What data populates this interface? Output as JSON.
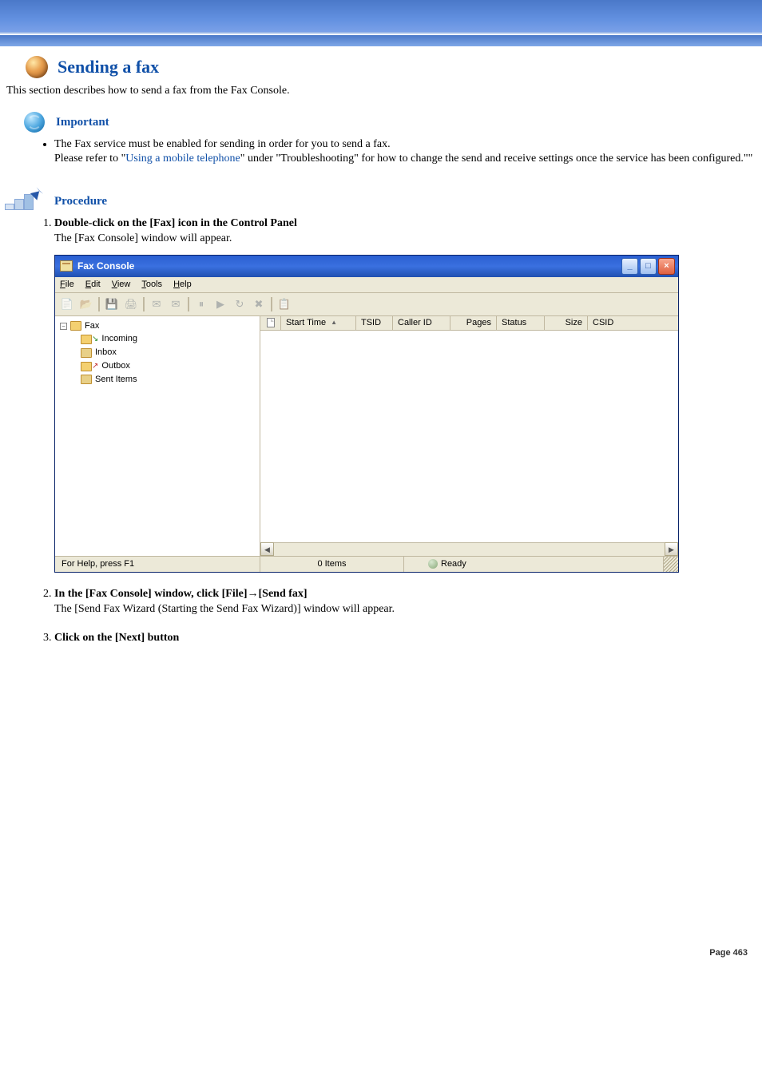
{
  "page_title": "Sending a fax",
  "intro_text": "This section describes how to send a fax from the Fax Console.",
  "important": {
    "label": "Important",
    "lines": [
      "The Fax service must be enabled for sending in order for you to send a fax.",
      "Please refer to \"",
      "Using a mobile telephone",
      "\" under \"Troubleshooting\" for how to change the send and receive settings once the service has been configured.\"\""
    ]
  },
  "procedure": {
    "label": "Procedure",
    "steps": [
      {
        "title": "Double-click on the [Fax] icon in the Control Panel",
        "body": "The [Fax Console] window will appear."
      },
      {
        "title": "In the [Fax Console] window, click [File]→[Send fax]",
        "body": "The [Send Fax Wizard (Starting the Send Fax Wizard)] window will appear."
      },
      {
        "title": "Click on the [Next] button",
        "body": ""
      }
    ]
  },
  "fax_window": {
    "title": "Fax Console",
    "menu": {
      "file": "File",
      "edit": "Edit",
      "view": "View",
      "tools": "Tools",
      "help": "Help"
    },
    "tree": {
      "root": "Fax",
      "items": [
        "Incoming",
        "Inbox",
        "Outbox",
        "Sent Items"
      ]
    },
    "columns": [
      "Start Time",
      "TSID",
      "Caller ID",
      "Pages",
      "Status",
      "Size",
      "CSID"
    ],
    "statusbar": {
      "help": "For Help, press F1",
      "items": "0 Items",
      "ready": "Ready"
    },
    "win_buttons": {
      "min": "_",
      "max": "□",
      "close": "×"
    },
    "toggle": "−"
  },
  "footer": "Page 463"
}
